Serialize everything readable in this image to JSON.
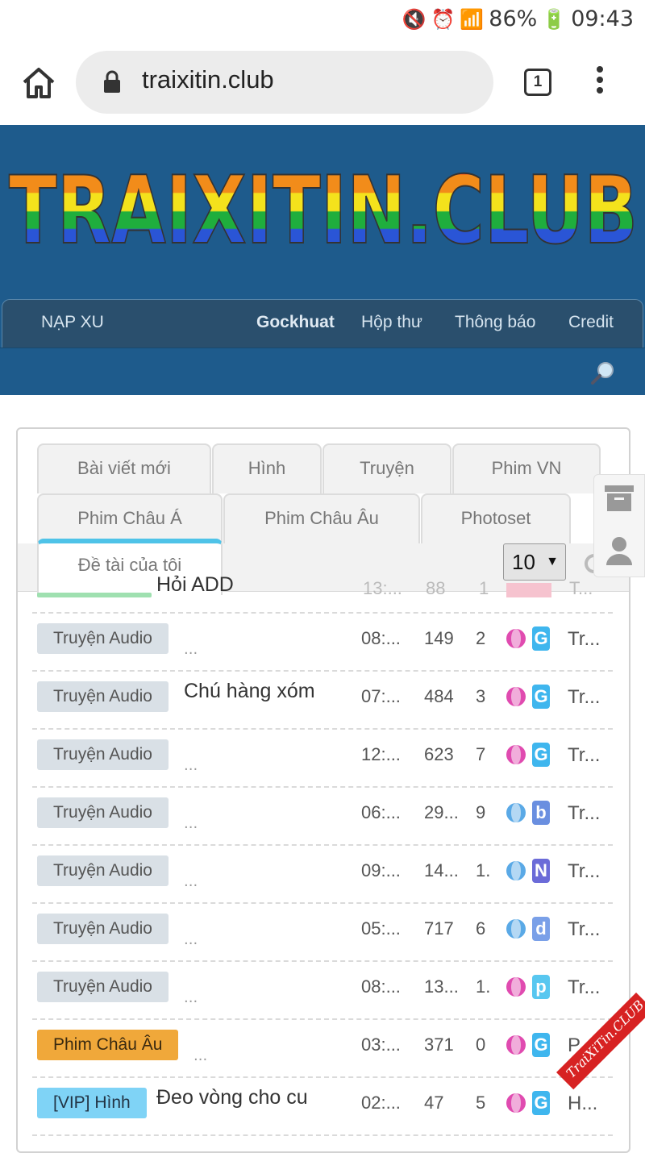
{
  "status_bar": {
    "battery": "86%",
    "time": "09:43"
  },
  "browser": {
    "url": "traixitin.club",
    "tab_count": "1"
  },
  "site": {
    "logo_text": "TRAIXITIN.CLUB",
    "nav": {
      "left": "NẠP XU",
      "user": "Gockhuat",
      "inbox": "Hộp thư",
      "alerts": "Thông báo",
      "credit": "Credit"
    }
  },
  "tabs": [
    "Bài viết mới",
    "Hình",
    "Truyện",
    "Phim VN",
    "Phim Châu Á",
    "Phim Châu Âu",
    "Photoset",
    "Đề tài của tôi"
  ],
  "per_page": "10",
  "rows": [
    {
      "title": "Hỏi ADD",
      "time": "13:...",
      "views": "88",
      "replies": "1",
      "last": "T..."
    },
    {
      "badge": "Truyện Audio",
      "title": "",
      "time": "08:...",
      "views": "149",
      "replies": "2",
      "letter": "G",
      "last": "Tr..."
    },
    {
      "badge": "Truyện Audio",
      "title": "Chú hàng xóm",
      "time": "07:...",
      "views": "484",
      "replies": "3",
      "letter": "G",
      "last": "Tr..."
    },
    {
      "badge": "Truyện Audio",
      "title": "",
      "time": "12:...",
      "views": "623",
      "replies": "7",
      "letter": "G",
      "last": "Tr..."
    },
    {
      "badge": "Truyện Audio",
      "title": "",
      "time": "06:...",
      "views": "29...",
      "replies": "9",
      "letter": "b",
      "last": "Tr..."
    },
    {
      "badge": "Truyện Audio",
      "title": "",
      "time": "09:...",
      "views": "14...",
      "replies": "1.",
      "letter": "N",
      "last": "Tr..."
    },
    {
      "badge": "Truyện Audio",
      "title": "",
      "time": "05:...",
      "views": "717",
      "replies": "6",
      "letter": "d",
      "last": "Tr..."
    },
    {
      "badge": "Truyện Audio",
      "title": "",
      "time": "08:...",
      "views": "13...",
      "replies": "1.",
      "letter": "p",
      "last": "Tr..."
    },
    {
      "badge": "Phim Châu Âu",
      "title": "",
      "time": "03:...",
      "views": "371",
      "replies": "0",
      "letter": "G",
      "last": "P..."
    },
    {
      "badge": "[VIP] Hình",
      "title": "Đeo vòng cho cu",
      "time": "02:...",
      "views": "47",
      "replies": "5",
      "letter": "G",
      "last": "H..."
    }
  ],
  "ellipsis": "...",
  "watermark": "TraiXiTin.CLUB",
  "colors": {
    "header_bg": "#1e5b8c",
    "nav_bg": "#2a4f6d",
    "badge_grey": "#d9e0e6",
    "badge_orange": "#f0a83a",
    "badge_blue": "#7fd3f6",
    "tab_accent": "#4fc3e8"
  }
}
